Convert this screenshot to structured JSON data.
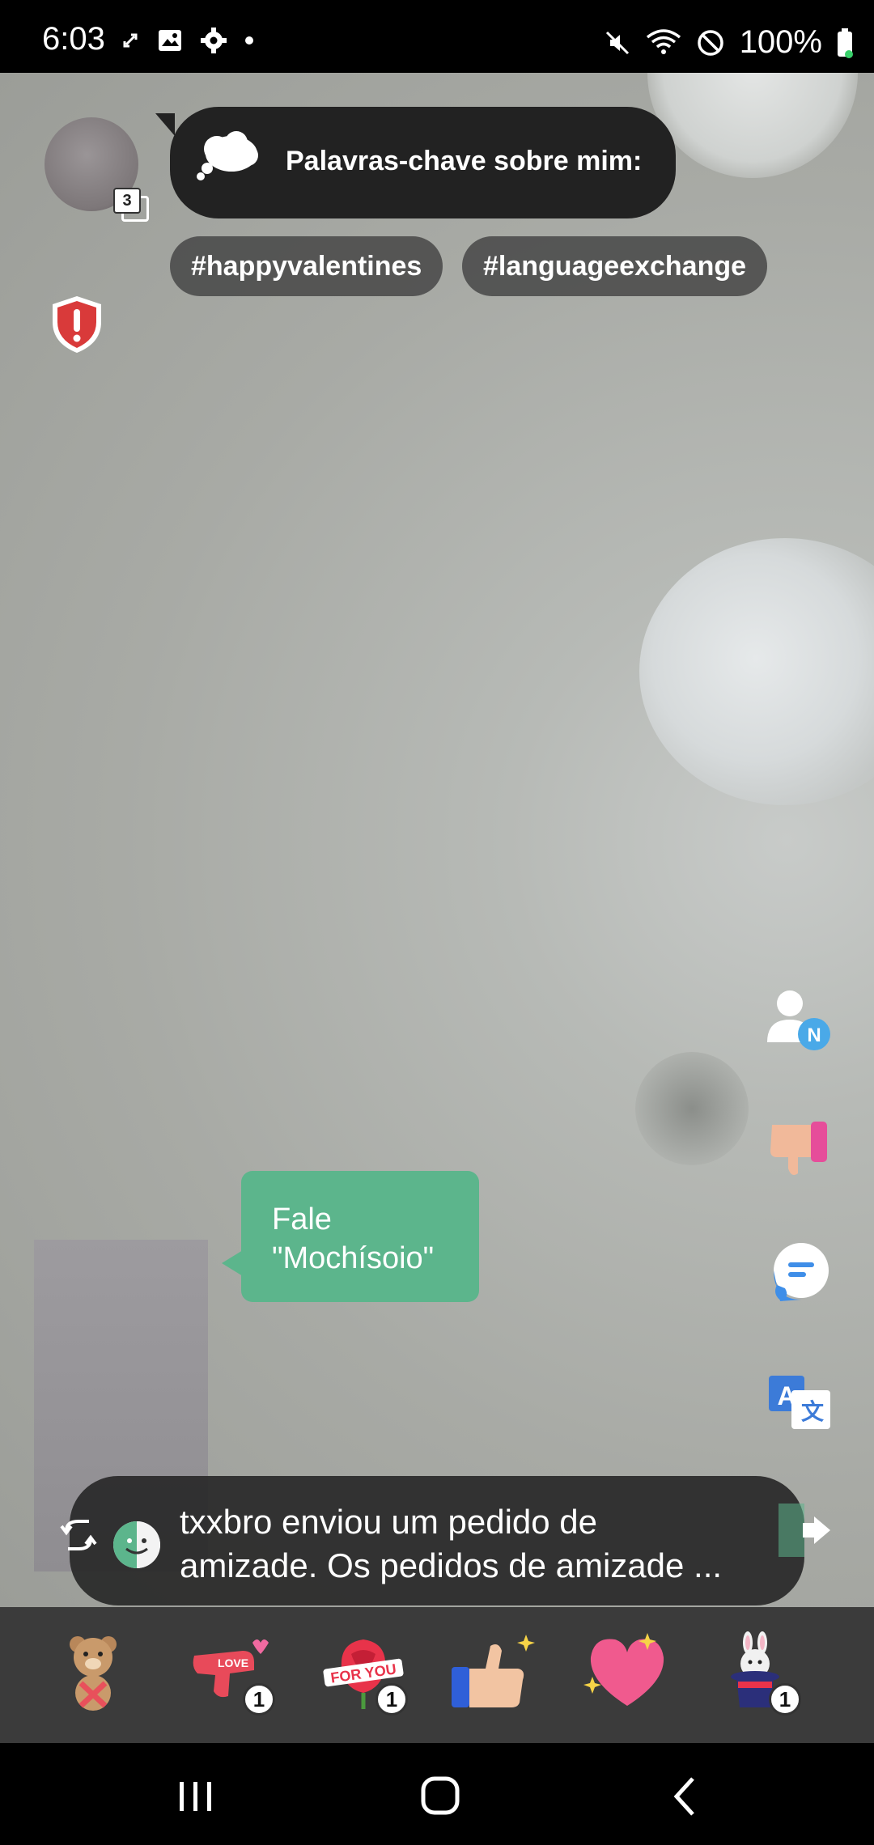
{
  "status_bar": {
    "time": "6:03",
    "battery_percent": "100%",
    "left_icons": [
      "sync-icon",
      "image-icon",
      "settings-icon",
      "dot-icon"
    ],
    "right_icons": [
      "mute-icon",
      "wifi-icon",
      "do-not-disturb-icon",
      "battery-icon"
    ]
  },
  "profile": {
    "photo_count": "3"
  },
  "keywords": {
    "title": "Palavras-chave sobre mim:",
    "tags": [
      "#happyvalentines",
      "#languageexchange"
    ]
  },
  "prompt": {
    "line1": "Fale",
    "line2": "\"Mochísoio\""
  },
  "side_buttons": [
    "add-friend-icon",
    "dislike-icon",
    "chat-icon",
    "translate-icon"
  ],
  "toast": {
    "line1": "txxbro enviou um pedido de",
    "line2": "amizade. Os pedidos de amizade ..."
  },
  "gifts": [
    {
      "name": "teddy-bear-gift",
      "count": ""
    },
    {
      "name": "love-gun-gift",
      "count": "1"
    },
    {
      "name": "for-you-rose-gift",
      "count": "1"
    },
    {
      "name": "thumbs-up-gift",
      "count": ""
    },
    {
      "name": "heart-gift",
      "count": ""
    },
    {
      "name": "magic-hat-bunny-gift",
      "count": "1"
    }
  ],
  "nav": [
    "recent-apps-icon",
    "home-icon",
    "back-icon"
  ],
  "colors": {
    "prompt_bubble": "#5cb58c",
    "gift_bar": "#3b3b3b",
    "shield": "#d93a3a"
  }
}
